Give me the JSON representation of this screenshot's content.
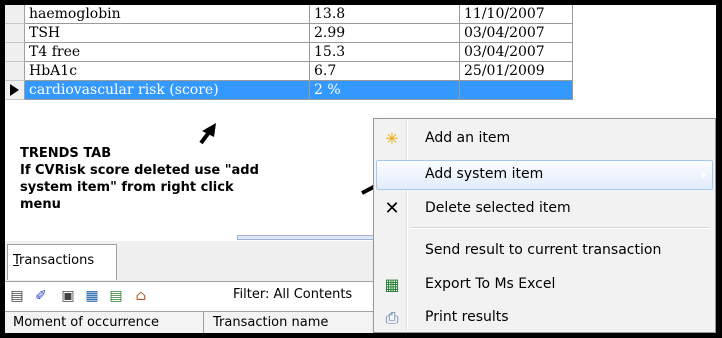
{
  "trends": {
    "rows": [
      {
        "name": "haemoglobin",
        "value": "13.8",
        "date": "11/10/2007"
      },
      {
        "name": "TSH",
        "value": "2.99",
        "date": "03/04/2007"
      },
      {
        "name": "T4 free",
        "value": "15.3",
        "date": "03/04/2007"
      },
      {
        "name": "HbA1c",
        "value": "6.7",
        "date": "25/01/2009"
      },
      {
        "name": "cardiovascular risk (score)",
        "value": "2 %",
        "date": ""
      }
    ]
  },
  "annotation": {
    "line1": "TRENDS TAB",
    "line2": "If CVRisk score deleted use \"add",
    "line3": "system item\" from right click",
    "line4": "menu"
  },
  "tabs": {
    "prefix": "T",
    "rest": "ransactions"
  },
  "toolbar": {
    "filter_label": "Filter: All Contents"
  },
  "columns": {
    "moment": "Moment of occurrence",
    "transaction": "Transaction name"
  },
  "context_menu": {
    "items": [
      {
        "label": "Add an item",
        "icon": "add-item-icon"
      },
      {
        "label": "Add system item",
        "icon": "none"
      },
      {
        "label": "Delete selected item",
        "icon": "delete-x-icon"
      },
      {
        "label": "Send result to current transaction",
        "icon": "none"
      },
      {
        "label": "Export To Ms Excel",
        "icon": "excel-icon"
      },
      {
        "label": "Print results",
        "icon": "printer-icon"
      }
    ]
  },
  "colors": {
    "selection": "#3399ff",
    "menu_bg": "#f2f2f2",
    "highlight_border": "#a8c8f0"
  }
}
